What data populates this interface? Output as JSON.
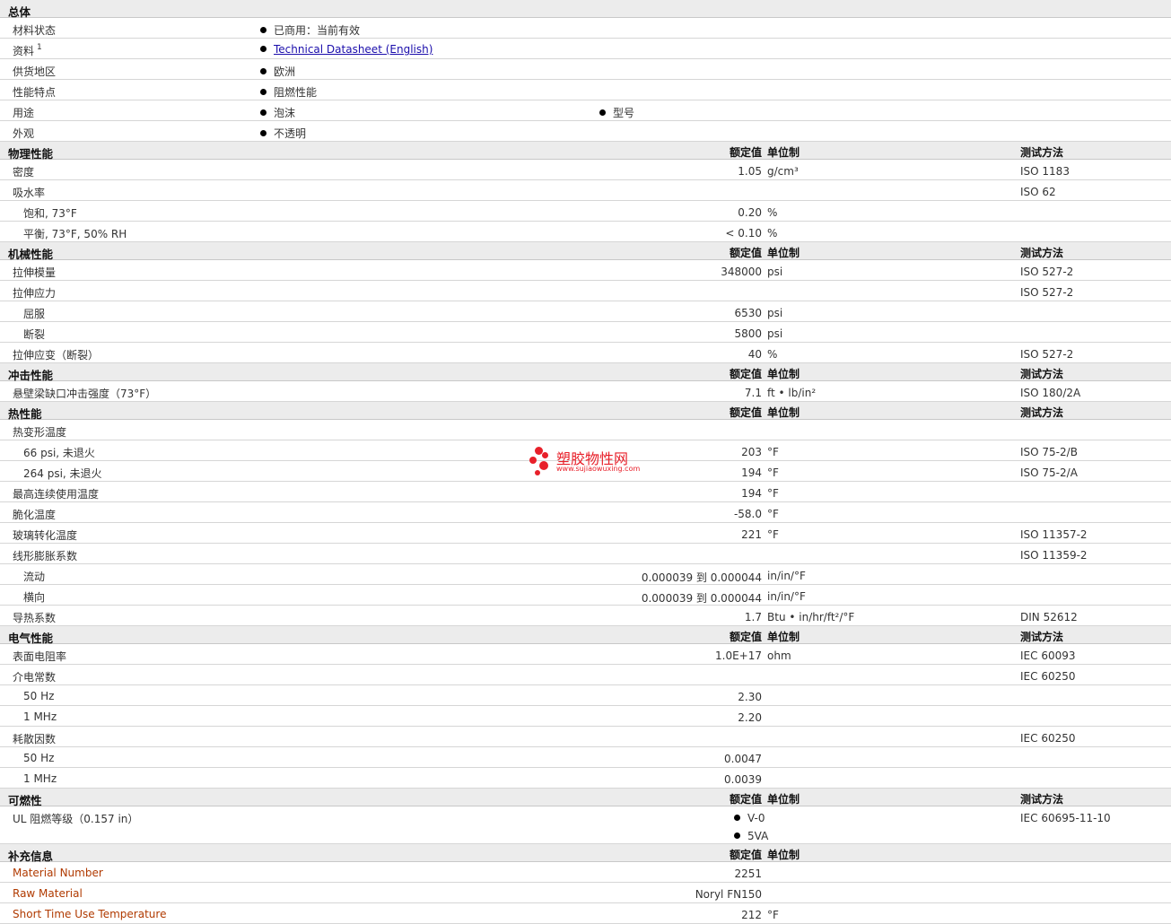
{
  "headers": {
    "value": "额定值",
    "unit": "单位制",
    "method": "测试方法"
  },
  "general": {
    "title": "总体",
    "rows": [
      {
        "label": "材料状态",
        "v1": "已商用：当前有效"
      },
      {
        "label": "资料",
        "sup": "1",
        "link": "Technical Datasheet (English)"
      },
      {
        "label": "供货地区",
        "v1": "欧洲"
      },
      {
        "label": "性能特点",
        "v1": "阻燃性能"
      },
      {
        "label": "用途",
        "v1": "泡沫",
        "v2": "型号"
      },
      {
        "label": "外观",
        "v1": "不透明"
      }
    ]
  },
  "physical": {
    "title": "物理性能",
    "rows": [
      {
        "label": "密度",
        "value": "1.05",
        "unit": "g/cm³",
        "method": "ISO 1183"
      },
      {
        "label": "吸水率",
        "value": "",
        "unit": "",
        "method": "ISO 62"
      },
      {
        "label": "饱和, 73°F",
        "value": "0.20",
        "unit": "%",
        "method": ""
      },
      {
        "label": "平衡, 73°F, 50% RH",
        "value": "< 0.10",
        "unit": "%",
        "method": ""
      }
    ]
  },
  "mechanical": {
    "title": "机械性能",
    "rows": [
      {
        "label": "拉伸模量",
        "value": "348000",
        "unit": "psi",
        "method": "ISO 527-2"
      },
      {
        "label": "拉伸应力",
        "value": "",
        "unit": "",
        "method": "ISO 527-2"
      },
      {
        "label": "屈服",
        "value": "6530",
        "unit": "psi",
        "method": ""
      },
      {
        "label": "断裂",
        "value": "5800",
        "unit": "psi",
        "method": ""
      },
      {
        "label": "拉伸应变（断裂）",
        "value": "40",
        "unit": "%",
        "method": "ISO 527-2"
      }
    ]
  },
  "impact": {
    "title": "冲击性能",
    "rows": [
      {
        "label": "悬壁梁缺口冲击强度（73°F）",
        "value": "7.1",
        "unit": "ft • lb/in²",
        "method": "ISO 180/2A"
      }
    ]
  },
  "thermal": {
    "title": "热性能",
    "rows": [
      {
        "label": "热变形温度",
        "value": "",
        "unit": "",
        "method": ""
      },
      {
        "label": "66 psi, 未退火",
        "value": "203",
        "unit": "°F",
        "method": "ISO 75-2/B"
      },
      {
        "label": "264 psi, 未退火",
        "value": "194",
        "unit": "°F",
        "method": "ISO 75-2/A"
      },
      {
        "label": "最高连续使用温度",
        "value": "194",
        "unit": "°F",
        "method": ""
      },
      {
        "label": "脆化温度",
        "value": "-58.0",
        "unit": "°F",
        "method": ""
      },
      {
        "label": "玻璃转化温度",
        "value": "221",
        "unit": "°F",
        "method": "ISO 11357-2"
      },
      {
        "label": "线形膨胀系数",
        "value": "",
        "unit": "",
        "method": "ISO 11359-2"
      },
      {
        "label": "流动",
        "value": "0.000039 到 0.000044",
        "unit": "in/in/°F",
        "method": ""
      },
      {
        "label": "横向",
        "value": "0.000039 到 0.000044",
        "unit": "in/in/°F",
        "method": ""
      },
      {
        "label": "导热系数",
        "value": "1.7",
        "unit": "Btu • in/hr/ft²/°F",
        "method": "DIN 52612"
      }
    ]
  },
  "electrical": {
    "title": "电气性能",
    "rows": [
      {
        "label": "表面电阻率",
        "value": "1.0E+17",
        "unit": "ohm",
        "method": "IEC 60093"
      },
      {
        "label": "介电常数",
        "value": "",
        "unit": "",
        "method": "IEC 60250"
      },
      {
        "label": "50 Hz",
        "value": "2.30",
        "unit": "",
        "method": ""
      },
      {
        "label": "1 MHz",
        "value": "2.20",
        "unit": "",
        "method": ""
      },
      {
        "label": "耗散因数",
        "value": "",
        "unit": "",
        "method": "IEC 60250"
      },
      {
        "label": "50 Hz",
        "value": "0.0047",
        "unit": "",
        "method": ""
      },
      {
        "label": "1 MHz",
        "value": "0.0039",
        "unit": "",
        "method": ""
      }
    ]
  },
  "flammability": {
    "title": "可燃性",
    "row": {
      "label": "UL 阻燃等级（0.157 in）",
      "v1": "V-0",
      "v2": "5VA",
      "method": "IEC 60695-11-10"
    }
  },
  "supplementary": {
    "title": "补充信息",
    "rows": [
      {
        "label": "Material Number",
        "value": "2251",
        "unit": ""
      },
      {
        "label": "Raw Material",
        "value": "Noryl FN150",
        "unit": ""
      },
      {
        "label": "Short Time Use Temperature",
        "value": "212",
        "unit": "°F"
      }
    ]
  },
  "watermark": {
    "text": "塑胶物性网",
    "url": "www.sujiaowuxing.com"
  }
}
